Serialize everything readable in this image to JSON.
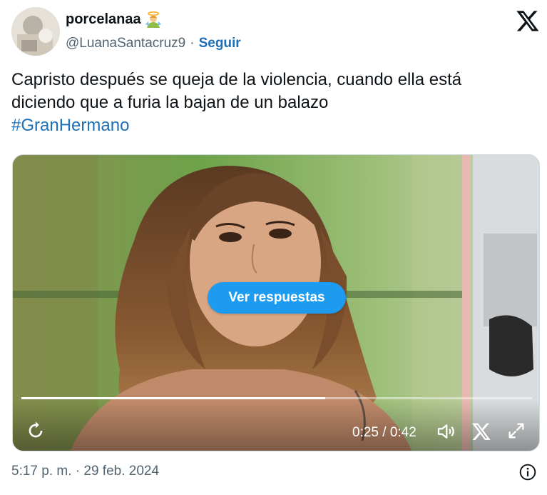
{
  "author": {
    "display_name": "porcelanaa",
    "name_emoji_icon": "person-with-halo-emoji-icon",
    "handle": "@LuanaSantacruz9",
    "separator": "·",
    "follow_label": "Seguir"
  },
  "tweet": {
    "line1": "Capristo después se queja de la violencia, cuando ella está",
    "line2": "diciendo que a furia la bajan de un balazo",
    "hashtag": "#GranHermano"
  },
  "media": {
    "replies_button": "Ver respuestas",
    "time_display": "0:25 / 0:42",
    "progress": 0.595,
    "icons": [
      "replay-icon",
      "volume-icon",
      "x-logo-icon",
      "fullscreen-icon"
    ]
  },
  "footer": {
    "timestamp": "5:17 p. m. · 29 feb. 2024",
    "info_icon": "info-icon"
  },
  "colors": {
    "link": "#1d6fb8",
    "button_blue": "#1d9bf0",
    "muted": "#536471",
    "text": "#0f1419"
  }
}
